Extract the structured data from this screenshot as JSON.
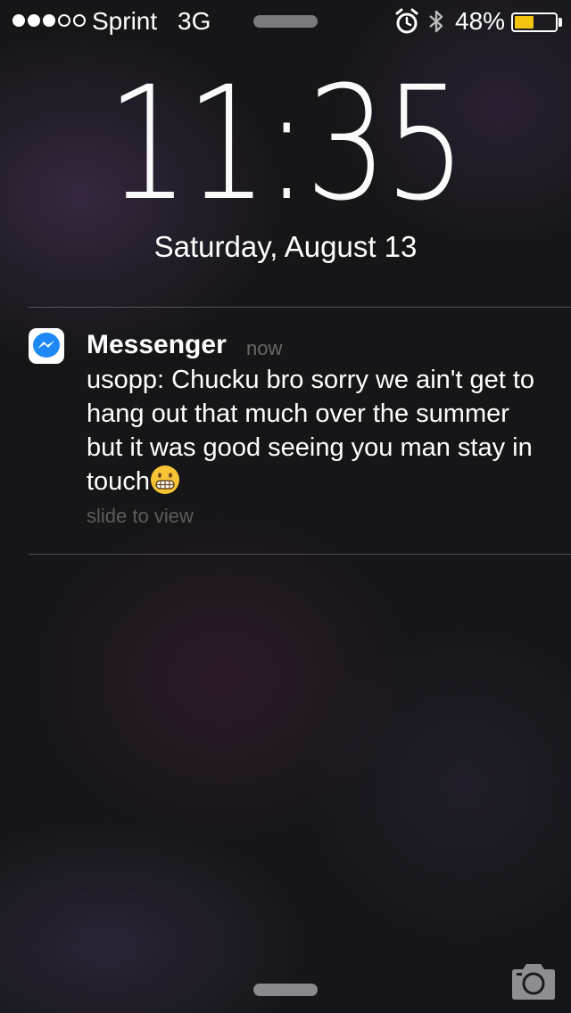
{
  "status_bar": {
    "signal_bars_filled": 3,
    "signal_bars_total": 5,
    "carrier": "Sprint",
    "network": "3G",
    "battery_percent": "48%",
    "battery_level": 0.48,
    "battery_color": "#f1c40f",
    "icons": [
      "alarm-icon",
      "bluetooth-icon"
    ]
  },
  "lock_screen": {
    "time": "11:35",
    "date": "Saturday, August 13"
  },
  "notification": {
    "app_name": "Messenger",
    "timestamp": "now",
    "message": "usopp: Chucku bro sorry we ain't get to hang out that much over the summer but it was good seeing you man stay in touch",
    "emoji": "grimacing-face",
    "hint": "slide to view",
    "accent_color": "#1e88f5"
  },
  "bottom": {
    "camera_icon": "camera-icon"
  }
}
